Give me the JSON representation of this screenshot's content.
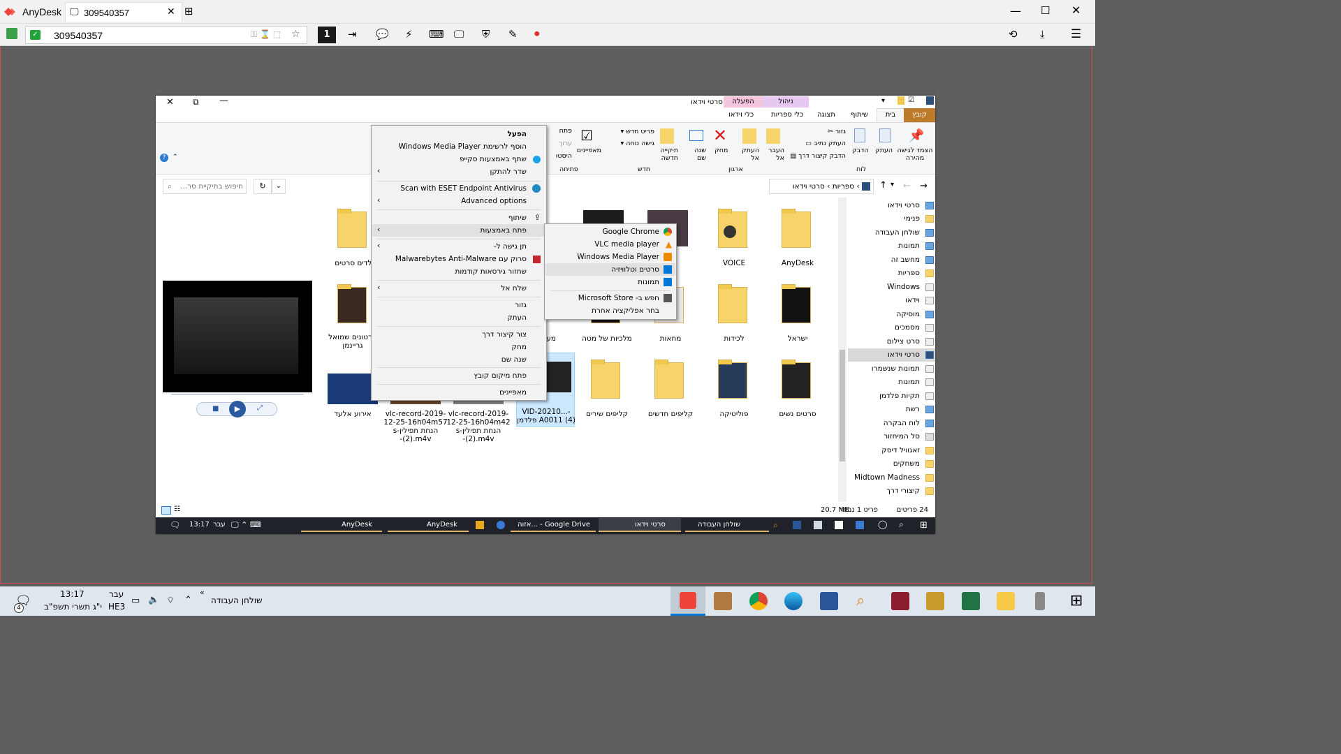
{
  "anydesk": {
    "app_name": "AnyDesk",
    "tab_label": "309540357",
    "address_value": "309540357",
    "session_number": "1"
  },
  "explorer": {
    "title": "סרטי וידאו",
    "ribbon_tabs": [
      "קובץ",
      "בית",
      "שיתוף",
      "תצוגה",
      "כלי ספריות",
      "כלי וידאו"
    ],
    "context_tabs": {
      "manage": "ניהול",
      "play": "הפעלה"
    },
    "ribbon": {
      "pin": "הצמד לגישה מהירה",
      "copy": "העתק",
      "paste": "הדבק",
      "cut": "גזור",
      "copy_path": "העתק נתיב",
      "paste_shortcut": "הדבק קיצור דרך",
      "group_clipboard": "לוח",
      "move_to": "העבר אל",
      "copy_to": "העתק אל",
      "delete": "מחק",
      "rename": "שנה שם",
      "group_organize": "ארגון",
      "new_folder": "תיקייה חדשה",
      "new_item": "פריט חדש",
      "easy_access": "גישה נוחה",
      "group_new": "חדש",
      "properties": "מאפיינים",
      "open": "פתח",
      "edit": "ערוך",
      "history": "היסטו",
      "group_open": "פתיחה"
    },
    "breadcrumb": [
      "ספריות",
      "סרטי וידאו"
    ],
    "search_placeholder": "חיפוש בתיקיית סר...",
    "nav": [
      "סרטי וידאו",
      "פנימי",
      "שולחן העבודה",
      "תמונות",
      "מחשב זה",
      "ספריות",
      "Windows",
      "וידאו",
      "מוסיקה",
      "מסמכים",
      "סרט צילום",
      "סרטי וידאו",
      "תמונות שנשמרו",
      "תמונות",
      "תקיות פלדמן",
      "רשת",
      "לוח הבקרה",
      "סל המיחזור",
      "זאגוויל דיסק",
      "משחקים",
      "Midtown Madness",
      "קיצורי דרך"
    ],
    "files": [
      {
        "name": "AnyDesk"
      },
      {
        "name": "VOICE"
      },
      {
        "name": "ישראל"
      },
      {
        "name": "לכידות"
      },
      {
        "name": "מחאות"
      },
      {
        "name": "מלכיות של מטה"
      },
      {
        "name": "מעורבים"
      },
      {
        "name": "סרטונים שמואל גריינמן"
      },
      {
        "name": "סרטים נשים"
      },
      {
        "name": "פוליטיקה"
      },
      {
        "name": "קליפים חדשים"
      },
      {
        "name": "קליפים שירים"
      },
      {
        "name": "VID-20210...-A0011 (4) פלדמן"
      },
      {
        "name": "vlc-record-2019-12-25-16h04m42 הנחת תפילין-s (2).m4v-"
      },
      {
        "name": "vlc-record-2019-12-25-16h04m57 הנחת תפילין-s (2).m4v-"
      },
      {
        "name": "אירוע אלעד"
      },
      {
        "name": "ילדים סרטים"
      }
    ],
    "status": {
      "count": "24 פריטים",
      "selected": "פריט 1 נבחר",
      "size": "20.7 MB"
    },
    "context_menu": [
      "הפעל",
      "הוסף לרשימת Windows Media Player",
      "שתף באמצעות סקייפ",
      "שדר להתקן",
      "Scan with ESET Endpoint Antivirus",
      "Advanced options",
      "שיתוף",
      "פתח באמצעות",
      "תן גישה ל-",
      "סרוק עם Malwarebytes Anti-Malware",
      "שחזור גירסאות קודמות",
      "שלח אל",
      "גזור",
      "העתק",
      "צור קיצור דרך",
      "מחק",
      "שנה שם",
      "פתח מיקום קובץ",
      "מאפיינים"
    ],
    "open_with": [
      "Google Chrome",
      "VLC media player",
      "Windows Media Player",
      "סרטים וטלוויזיה",
      "תמונות",
      "חפש ב- Microsoft Store",
      "בחר אפליקציה אחרת"
    ]
  },
  "remote_taskbar": {
    "time": "13:17",
    "lang": "עבר",
    "items": [
      "AnyDesk",
      "AnyDesk",
      "אזוה... - Google Drive",
      "סרטי וידאו",
      "שולחן העבודה"
    ]
  },
  "local_taskbar": {
    "time": "13:17",
    "date": "י\"ג תשרי תשפ\"ב",
    "lang_top": "עבר",
    "lang_bottom": "HE3",
    "notif_count": "4",
    "desktop_label": "שולחן העבודה"
  },
  "colors": {
    "anydesk_red": "#ef443b",
    "selection": "#cce8ff",
    "ribbon_bg": "#f5f6f7",
    "taskbar_dark": "#1f2329"
  }
}
